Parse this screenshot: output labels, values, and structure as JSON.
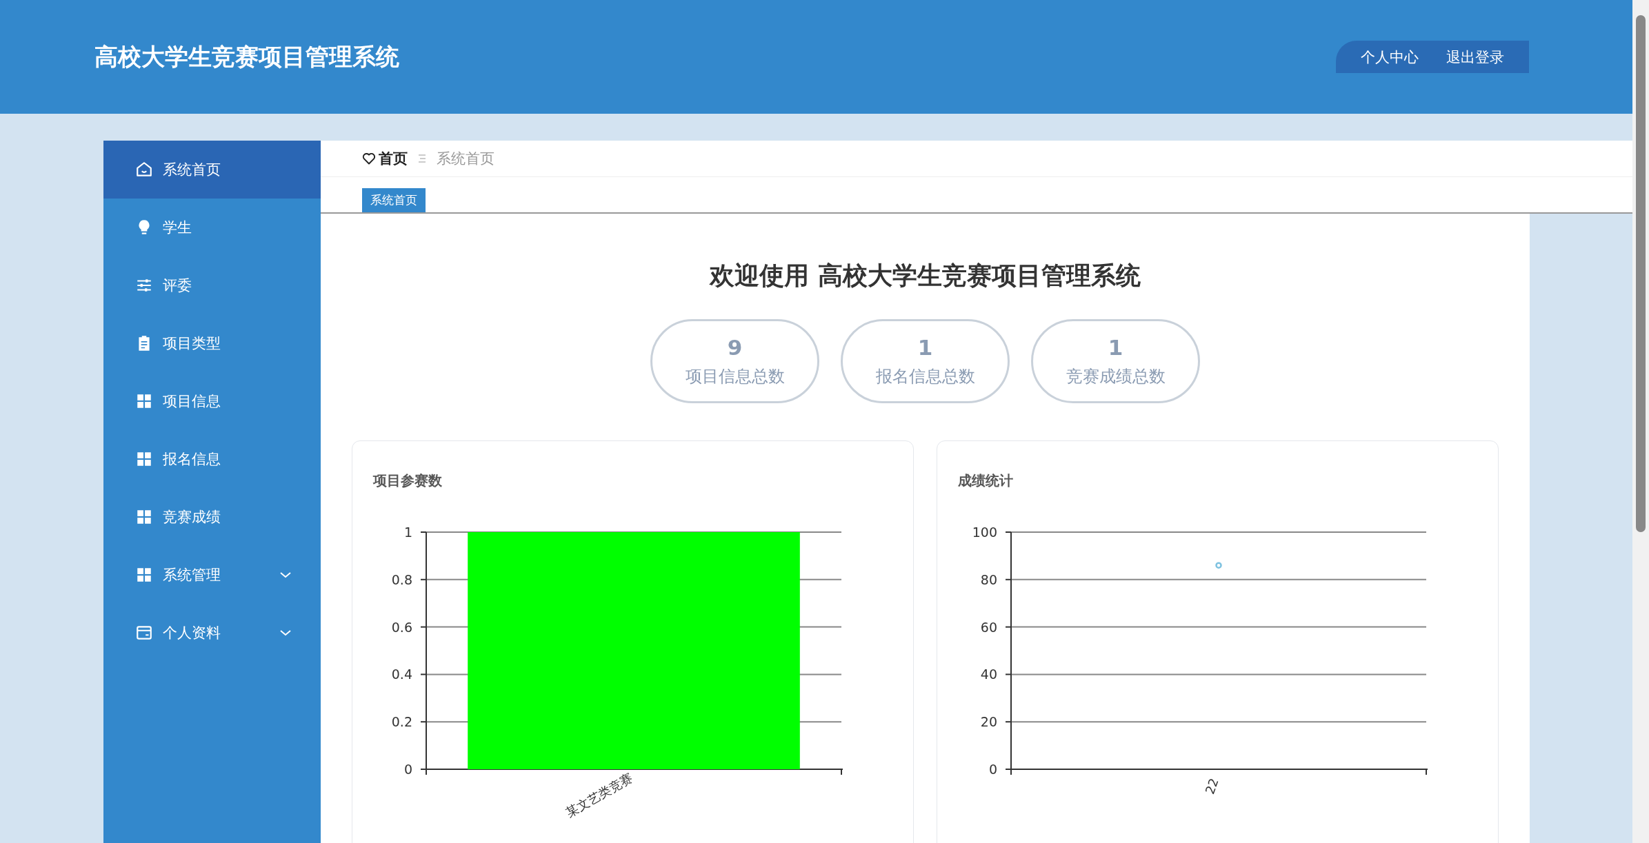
{
  "header": {
    "title": "高校大学生竞赛项目管理系统",
    "links": [
      "个人中心",
      "退出登录"
    ]
  },
  "sidebar": {
    "items": [
      {
        "label": "系统首页",
        "selected": true,
        "expandable": false
      },
      {
        "label": "学生",
        "selected": false,
        "expandable": false
      },
      {
        "label": "评委",
        "selected": false,
        "expandable": false
      },
      {
        "label": "项目类型",
        "selected": false,
        "expandable": false
      },
      {
        "label": "项目信息",
        "selected": false,
        "expandable": false
      },
      {
        "label": "报名信息",
        "selected": false,
        "expandable": false
      },
      {
        "label": "竞赛成绩",
        "selected": false,
        "expandable": false
      },
      {
        "label": "系统管理",
        "selected": false,
        "expandable": true
      },
      {
        "label": "个人资料",
        "selected": false,
        "expandable": true
      }
    ]
  },
  "breadcrumb": {
    "home": "首页",
    "current": "系统首页"
  },
  "tabs": [
    {
      "label": "系统首页",
      "selected": true
    }
  ],
  "welcome": "欢迎使用 高校大学生竞赛项目管理系统",
  "stats": [
    {
      "value": "9",
      "label": "项目信息总数"
    },
    {
      "value": "1",
      "label": "报名信息总数"
    },
    {
      "value": "1",
      "label": "竞赛成绩总数"
    }
  ],
  "charts": [
    {
      "chart_data": {
        "type": "bar",
        "title": "项目参赛数",
        "categories": [
          "某文艺类竞赛"
        ],
        "series": [
          {
            "color": "#00ff00",
            "values": [
              1
            ]
          }
        ],
        "grid": true,
        "ylim": [
          0,
          1
        ],
        "yticks": [
          0,
          0.2,
          0.4,
          0.6,
          0.8,
          1
        ]
      }
    },
    {
      "chart_data": {
        "type": "line",
        "title": "成绩统计",
        "categories": [
          "22"
        ],
        "series": [
          {
            "color": "#7ec2e0",
            "marker": "circle",
            "values": [
              86
            ]
          }
        ],
        "grid": true,
        "ylim": [
          0,
          100
        ],
        "yticks": [
          0,
          20,
          40,
          60,
          80,
          100
        ]
      }
    }
  ]
}
